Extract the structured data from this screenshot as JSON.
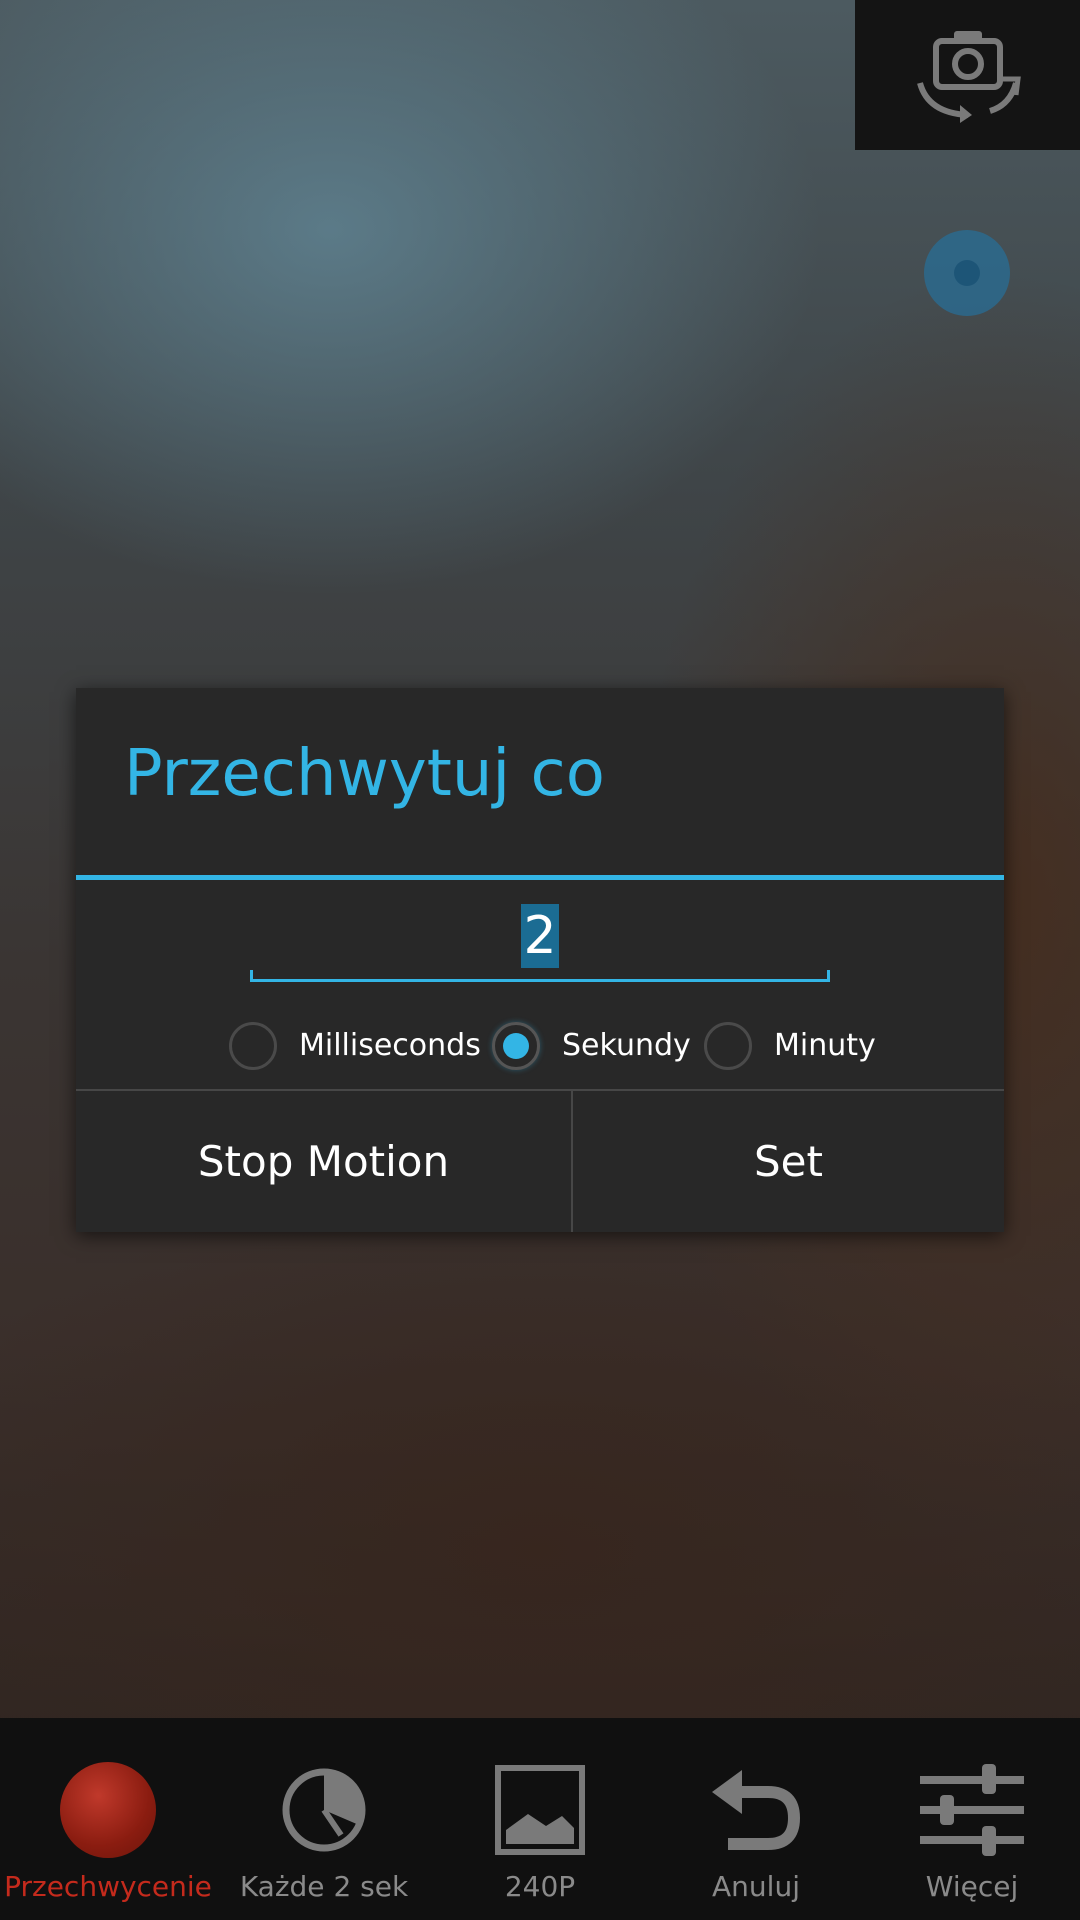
{
  "camera": {
    "switch_icon": "camera-switch-icon"
  },
  "dialog": {
    "title": "Przechwytuj co",
    "interval_value": "2",
    "units": [
      {
        "label": "Milliseconds",
        "checked": false
      },
      {
        "label": "Sekundy",
        "checked": true
      },
      {
        "label": "Minuty",
        "checked": false
      }
    ],
    "buttons": {
      "stop_motion": "Stop Motion",
      "set": "Set"
    }
  },
  "bottom_bar": {
    "tabs": [
      {
        "label": "Przechwycenie",
        "icon": "record-icon",
        "active": true
      },
      {
        "label": "Każde 2 sek",
        "icon": "timer-icon",
        "active": false
      },
      {
        "label": "240P",
        "icon": "image-icon",
        "active": false
      },
      {
        "label": "Anuluj",
        "icon": "undo-icon",
        "active": false
      },
      {
        "label": "Więcej",
        "icon": "sliders-icon",
        "active": false
      }
    ]
  },
  "colors": {
    "accent": "#33b5e5",
    "dialog_bg": "#282828",
    "record_red": "#c42a1c"
  }
}
